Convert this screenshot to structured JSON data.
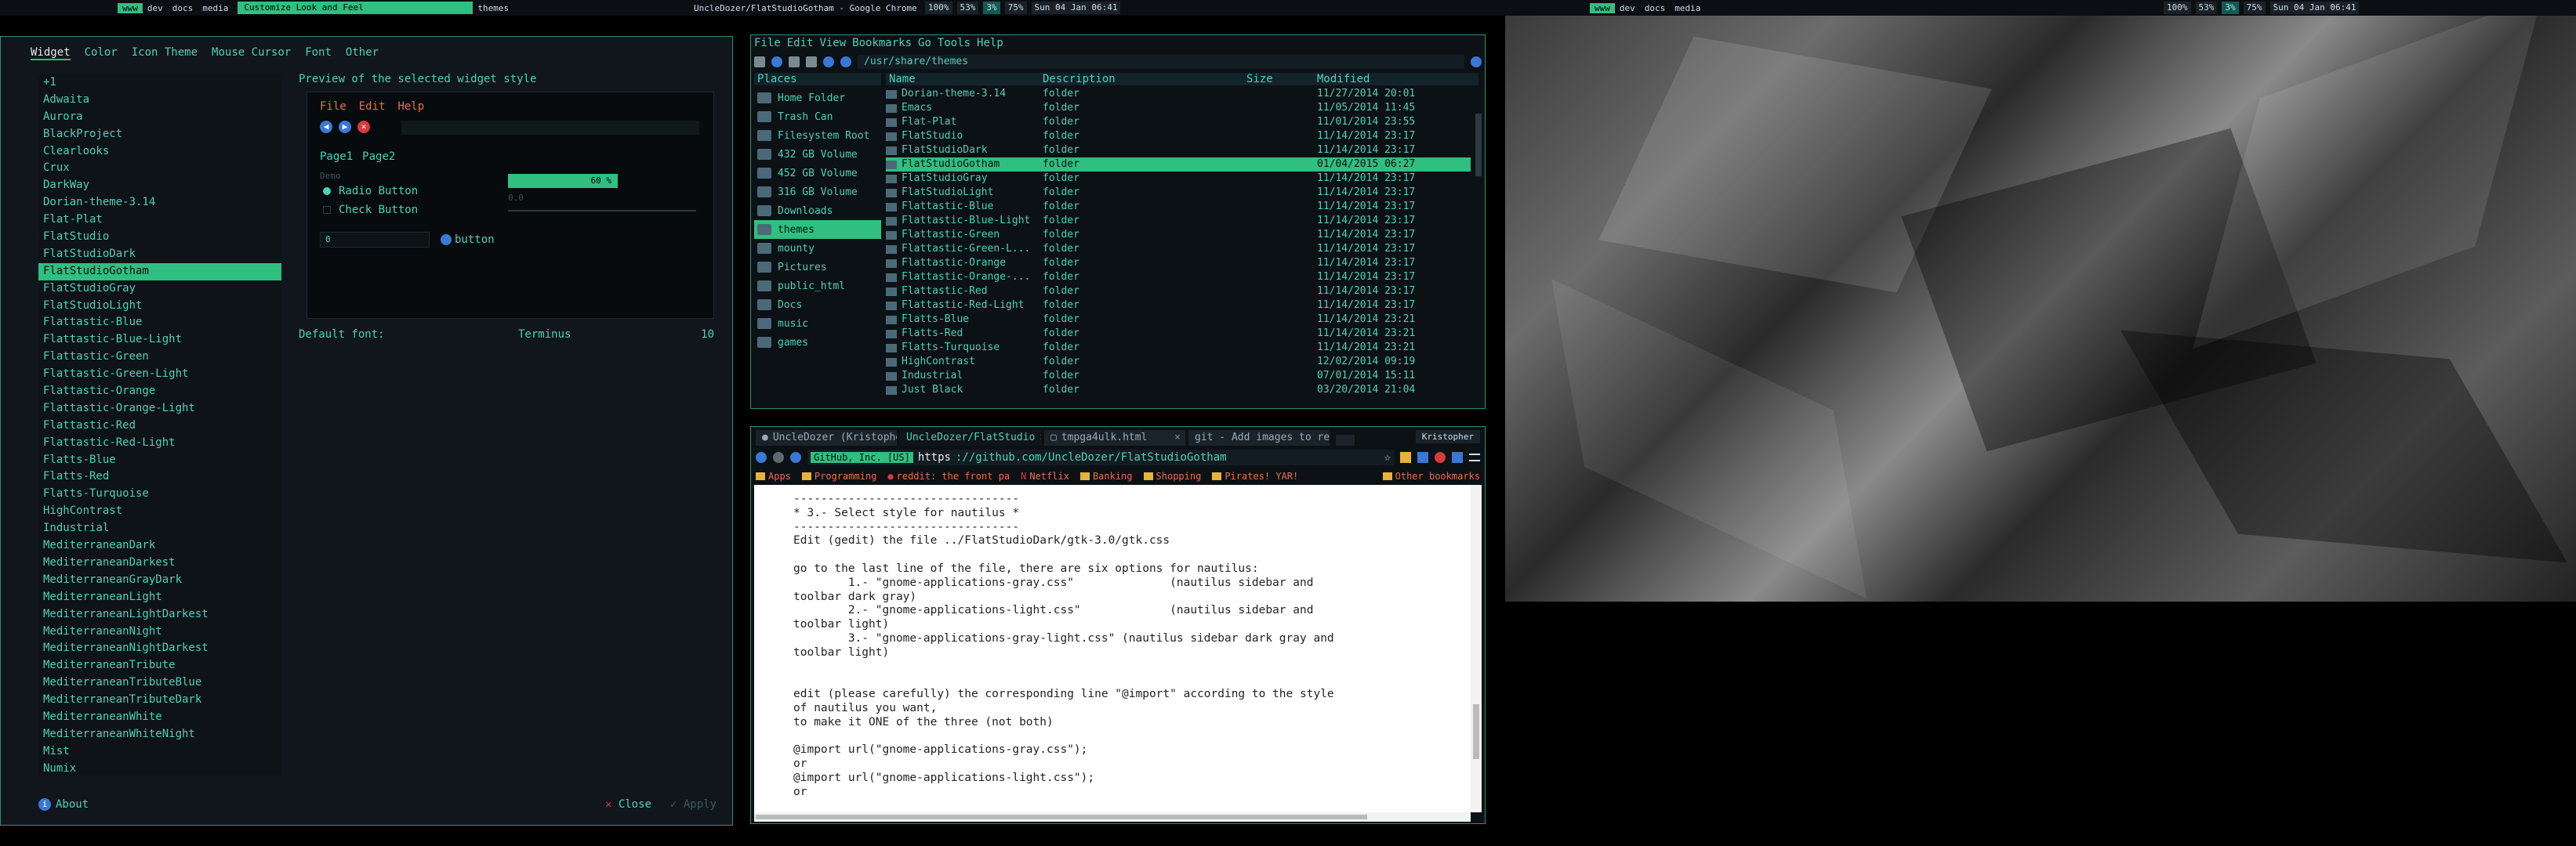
{
  "left_panel": {
    "workspaces": [
      "www",
      "dev",
      "docs",
      "media"
    ],
    "active_task": "Customize Look and Feel",
    "extra_task": "themes",
    "window_title": "UncleDozer/FlatStudioGotham - Google Chrome",
    "sys": [
      "100%",
      "53%",
      "3%",
      "75%"
    ],
    "clock": "Sun 04 Jan 06:41"
  },
  "right_panel": {
    "workspaces": [
      "www",
      "dev",
      "docs",
      "media"
    ],
    "sys": [
      "100%",
      "53%",
      "3%",
      "75%"
    ],
    "clock": "Sun 04 Jan 06:41"
  },
  "lxa": {
    "tabs": [
      "Widget",
      "Color",
      "Icon Theme",
      "Mouse Cursor",
      "Font",
      "Other"
    ],
    "themes": [
      "+1",
      "Adwaita",
      "Aurora",
      "BlackProject",
      "Clearlooks",
      "Crux",
      "DarkWay",
      "Dorian-theme-3.14",
      "Flat-Plat",
      "FlatStudio",
      "FlatStudioDark",
      "FlatStudioGotham",
      "FlatStudioGray",
      "FlatStudioLight",
      "Flattastic-Blue",
      "Flattastic-Blue-Light",
      "Flattastic-Green",
      "Flattastic-Green-Light",
      "Flattastic-Orange",
      "Flattastic-Orange-Light",
      "Flattastic-Red",
      "Flattastic-Red-Light",
      "Flatts-Blue",
      "Flatts-Red",
      "Flatts-Turquoise",
      "HighContrast",
      "Industrial",
      "MediterraneanDark",
      "MediterraneanDarkest",
      "MediterraneanGrayDark",
      "MediterraneanLight",
      "MediterraneanLightDarkest",
      "MediterraneanNight",
      "MediterraneanNightDarkest",
      "MediterraneanTribute",
      "MediterraneanTributeBlue",
      "MediterraneanTributeDark",
      "MediterraneanWhite",
      "MediterraneanWhiteNight",
      "Mist",
      "Numix"
    ],
    "selected_theme": "FlatStudioGotham",
    "preview_label": "Preview of the selected widget style",
    "preview": {
      "menu": [
        "File",
        "Edit",
        "Help"
      ],
      "tabs": [
        "Page1",
        "Page2"
      ],
      "demo": "Demo",
      "radio": "Radio Button",
      "check": "Check Button",
      "progress": "60 %",
      "scale": "0.0",
      "spin": "0",
      "button": "button"
    },
    "default_font_label": "Default font:",
    "default_font_family": "Terminus",
    "default_font_size": "10",
    "about": "About",
    "close": "Close",
    "apply": "Apply"
  },
  "fm": {
    "menu": [
      "File",
      "Edit",
      "View",
      "Bookmarks",
      "Go",
      "Tools",
      "Help"
    ],
    "path": "/usr/share/themes",
    "places_header": "Places",
    "places": [
      "Home Folder",
      "Trash Can",
      "Filesystem Root",
      "432 GB Volume",
      "452 GB Volume",
      "316 GB Volume",
      "Downloads",
      "themes",
      "mounty",
      "Pictures",
      "public_html",
      "Docs",
      "music",
      "games"
    ],
    "selected_place": "themes",
    "columns": {
      "name": "Name",
      "desc": "Description",
      "size": "Size",
      "modified": "Modified"
    },
    "rows": [
      {
        "name": "Dorian-theme-3.14",
        "desc": "folder",
        "mod": "11/27/2014 20:01"
      },
      {
        "name": "Emacs",
        "desc": "folder",
        "mod": "11/05/2014 11:45"
      },
      {
        "name": "Flat-Plat",
        "desc": "folder",
        "mod": "11/01/2014 23:55"
      },
      {
        "name": "FlatStudio",
        "desc": "folder",
        "mod": "11/14/2014 23:17"
      },
      {
        "name": "FlatStudioDark",
        "desc": "folder",
        "mod": "11/14/2014 23:17"
      },
      {
        "name": "FlatStudioGotham",
        "desc": "folder",
        "mod": "01/04/2015 06:27"
      },
      {
        "name": "FlatStudioGray",
        "desc": "folder",
        "mod": "11/14/2014 23:17"
      },
      {
        "name": "FlatStudioLight",
        "desc": "folder",
        "mod": "11/14/2014 23:17"
      },
      {
        "name": "Flattastic-Blue",
        "desc": "folder",
        "mod": "11/14/2014 23:17"
      },
      {
        "name": "Flattastic-Blue-Light",
        "desc": "folder",
        "mod": "11/14/2014 23:17"
      },
      {
        "name": "Flattastic-Green",
        "desc": "folder",
        "mod": "11/14/2014 23:17"
      },
      {
        "name": "Flattastic-Green-L...",
        "desc": "folder",
        "mod": "11/14/2014 23:17"
      },
      {
        "name": "Flattastic-Orange",
        "desc": "folder",
        "mod": "11/14/2014 23:17"
      },
      {
        "name": "Flattastic-Orange-...",
        "desc": "folder",
        "mod": "11/14/2014 23:17"
      },
      {
        "name": "Flattastic-Red",
        "desc": "folder",
        "mod": "11/14/2014 23:17"
      },
      {
        "name": "Flattastic-Red-Light",
        "desc": "folder",
        "mod": "11/14/2014 23:17"
      },
      {
        "name": "Flatts-Blue",
        "desc": "folder",
        "mod": "11/14/2014 23:21"
      },
      {
        "name": "Flatts-Red",
        "desc": "folder",
        "mod": "11/14/2014 23:21"
      },
      {
        "name": "Flatts-Turquoise",
        "desc": "folder",
        "mod": "11/14/2014 23:21"
      },
      {
        "name": "HighContrast",
        "desc": "folder",
        "mod": "12/02/2014 09:19"
      },
      {
        "name": "Industrial",
        "desc": "folder",
        "mod": "07/01/2014 15:11"
      },
      {
        "name": "Just Black",
        "desc": "folder",
        "mod": "03/20/2014 21:04"
      }
    ],
    "selected_row": "FlatStudioGotham"
  },
  "chrome": {
    "tabs": [
      "UncleDozer (Kristopher)",
      "UncleDozer/FlatStudio",
      "tmpga4ulk.html",
      "git - Add images to rea"
    ],
    "active_tab": 1,
    "user": "Kristopher",
    "ev_label": "GitHub, Inc. [US]",
    "url_scheme": "https",
    "url_rest": "://github.com/UncleDozer/FlatStudioGotham",
    "bookmarks": [
      "Apps",
      "Programming",
      "reddit: the front pa",
      "Netflix",
      "Banking",
      "Shopping",
      "Pirates! YAR!"
    ],
    "other_bookmarks": "Other bookmarks",
    "content_lines": [
      "---------------------------------",
      "* 3.- Select style for nautilus *",
      "---------------------------------",
      "Edit (gedit) the file ../FlatStudioDark/gtk-3.0/gtk.css",
      "",
      "go to the last line of the file, there are six options for nautilus:",
      "        1.- \"gnome-applications-gray.css\"              (nautilus sidebar and",
      "toolbar dark gray)",
      "        2.- \"gnome-applications-light.css\"             (nautilus sidebar and",
      "toolbar light)",
      "        3.- \"gnome-applications-gray-light.css\" (nautilus sidebar dark gray and",
      "toolbar light)",
      "",
      "",
      "edit (please carefully) the corresponding line \"@import\" according to the style",
      "of nautilus you want,",
      "to make it ONE of the three (not both)",
      "",
      "@import url(\"gnome-applications-gray.css\");",
      "or",
      "@import url(\"gnome-applications-light.css\");",
      "or"
    ]
  }
}
